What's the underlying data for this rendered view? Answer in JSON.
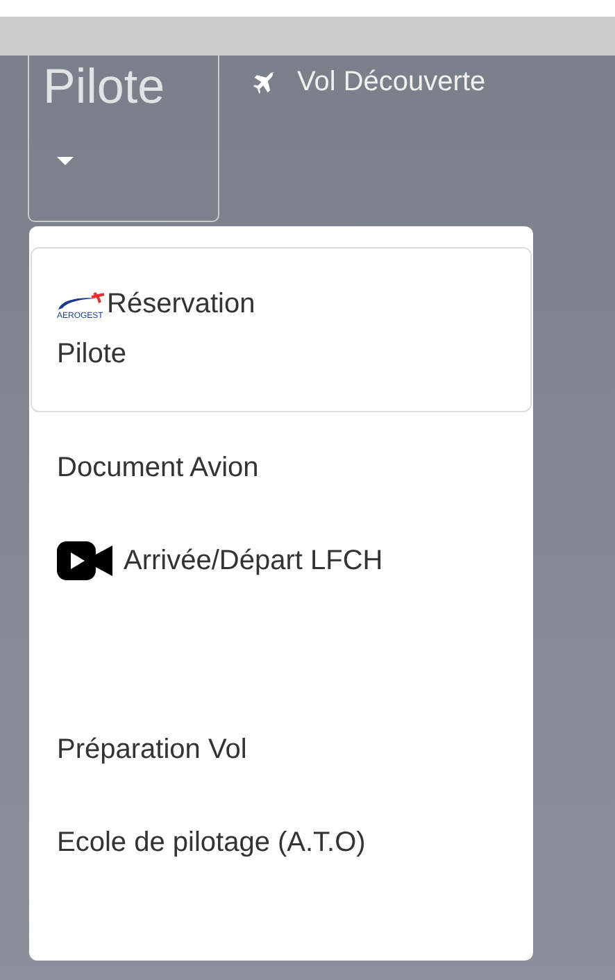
{
  "nav": {
    "menu_button": {
      "label": "Pilote",
      "expanded": true
    },
    "link": {
      "label": "Vol Découverte"
    }
  },
  "dropdown": {
    "items": [
      {
        "kind": "logo",
        "label": "Réservation Pilote",
        "logo_text": "AEROGEST",
        "selected": true
      },
      {
        "kind": "plain",
        "label": "Document Avion",
        "selected": false
      },
      {
        "kind": "video",
        "label": "Arrivée/Départ LFCH",
        "selected": false
      },
      {
        "kind": "plain",
        "label": "Préparation Vol",
        "selected": false
      },
      {
        "kind": "plain",
        "label": "Ecole de pilotage (A.T.O)",
        "selected": false
      }
    ]
  }
}
